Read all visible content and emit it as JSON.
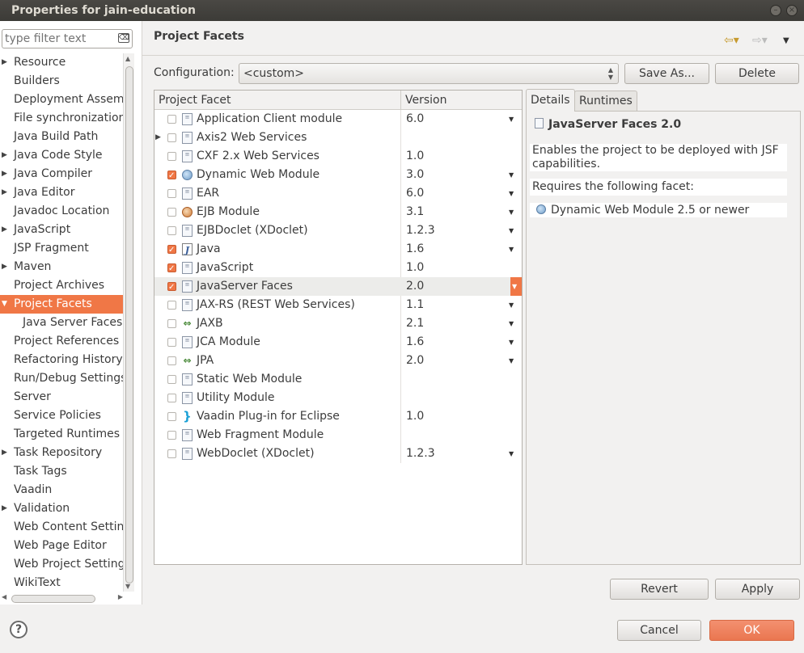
{
  "window": {
    "title": "Properties for jain-education",
    "btn_min": "–",
    "btn_max": "□",
    "btn_close": "×"
  },
  "filter": {
    "placeholder": "type filter text",
    "clear_glyph": "⌫"
  },
  "tree": {
    "items": [
      {
        "label": "Resource",
        "expandable": true,
        "expanded": false,
        "selected": false,
        "level": 0
      },
      {
        "label": "Builders",
        "expandable": false,
        "selected": false,
        "level": 0
      },
      {
        "label": "Deployment Assembly",
        "expandable": false,
        "selected": false,
        "level": 0
      },
      {
        "label": "File synchronization",
        "expandable": false,
        "selected": false,
        "level": 0
      },
      {
        "label": "Java Build Path",
        "expandable": false,
        "selected": false,
        "level": 0
      },
      {
        "label": "Java Code Style",
        "expandable": true,
        "expanded": false,
        "selected": false,
        "level": 0
      },
      {
        "label": "Java Compiler",
        "expandable": true,
        "expanded": false,
        "selected": false,
        "level": 0
      },
      {
        "label": "Java Editor",
        "expandable": true,
        "expanded": false,
        "selected": false,
        "level": 0
      },
      {
        "label": "Javadoc Location",
        "expandable": false,
        "selected": false,
        "level": 0
      },
      {
        "label": "JavaScript",
        "expandable": true,
        "expanded": false,
        "selected": false,
        "level": 0
      },
      {
        "label": "JSP Fragment",
        "expandable": false,
        "selected": false,
        "level": 0
      },
      {
        "label": "Maven",
        "expandable": true,
        "expanded": false,
        "selected": false,
        "level": 0
      },
      {
        "label": "Project Archives",
        "expandable": false,
        "selected": false,
        "level": 0
      },
      {
        "label": "Project Facets",
        "expandable": true,
        "expanded": true,
        "selected": true,
        "level": 0
      },
      {
        "label": "Java Server Faces",
        "expandable": false,
        "selected": false,
        "level": 1
      },
      {
        "label": "Project References",
        "expandable": false,
        "selected": false,
        "level": 0
      },
      {
        "label": "Refactoring History",
        "expandable": false,
        "selected": false,
        "level": 0
      },
      {
        "label": "Run/Debug Settings",
        "expandable": false,
        "selected": false,
        "level": 0
      },
      {
        "label": "Server",
        "expandable": false,
        "selected": false,
        "level": 0
      },
      {
        "label": "Service Policies",
        "expandable": false,
        "selected": false,
        "level": 0
      },
      {
        "label": "Targeted Runtimes",
        "expandable": false,
        "selected": false,
        "level": 0
      },
      {
        "label": "Task Repository",
        "expandable": true,
        "expanded": false,
        "selected": false,
        "level": 0
      },
      {
        "label": "Task Tags",
        "expandable": false,
        "selected": false,
        "level": 0
      },
      {
        "label": "Vaadin",
        "expandable": false,
        "selected": false,
        "level": 0
      },
      {
        "label": "Validation",
        "expandable": true,
        "expanded": false,
        "selected": false,
        "level": 0
      },
      {
        "label": "Web Content Settings",
        "expandable": false,
        "selected": false,
        "level": 0
      },
      {
        "label": "Web Page Editor",
        "expandable": false,
        "selected": false,
        "level": 0
      },
      {
        "label": "Web Project Settings",
        "expandable": false,
        "selected": false,
        "level": 0
      },
      {
        "label": "WikiText",
        "expandable": false,
        "selected": false,
        "level": 0
      }
    ]
  },
  "page": {
    "title": "Project Facets",
    "nav_back": "⇦▾",
    "nav_forward": "⇨▾",
    "nav_menu": "▼"
  },
  "configuration": {
    "label": "Configuration:",
    "value": "<custom>",
    "save_as": "Save As...",
    "delete": "Delete"
  },
  "facets": {
    "col_facet": "Project Facet",
    "col_version": "Version",
    "rows": [
      {
        "name": "Application Client module",
        "version": "6.0",
        "checked": false,
        "icon": "page-icon",
        "has_dropdown": true,
        "expandable": false,
        "selected": false
      },
      {
        "name": "Axis2 Web Services",
        "version": "",
        "checked": false,
        "icon": "page-icon",
        "has_dropdown": false,
        "expandable": true,
        "selected": false
      },
      {
        "name": "CXF 2.x Web Services",
        "version": "1.0",
        "checked": false,
        "icon": "page-icon",
        "has_dropdown": false,
        "expandable": false,
        "selected": false
      },
      {
        "name": "Dynamic Web Module",
        "version": "3.0",
        "checked": true,
        "icon": "web-module-icon",
        "has_dropdown": true,
        "expandable": false,
        "selected": false
      },
      {
        "name": "EAR",
        "version": "6.0",
        "checked": false,
        "icon": "page-icon",
        "has_dropdown": true,
        "expandable": false,
        "selected": false
      },
      {
        "name": "EJB Module",
        "version": "3.1",
        "checked": false,
        "icon": "ejb-module-icon",
        "has_dropdown": true,
        "expandable": false,
        "selected": false
      },
      {
        "name": "EJBDoclet (XDoclet)",
        "version": "1.2.3",
        "checked": false,
        "icon": "page-icon",
        "has_dropdown": true,
        "expandable": false,
        "selected": false
      },
      {
        "name": "Java",
        "version": "1.6",
        "checked": true,
        "icon": "java-icon",
        "has_dropdown": true,
        "expandable": false,
        "selected": false
      },
      {
        "name": "JavaScript",
        "version": "1.0",
        "checked": true,
        "icon": "page-icon",
        "has_dropdown": false,
        "expandable": false,
        "selected": false
      },
      {
        "name": "JavaServer Faces",
        "version": "2.0",
        "checked": true,
        "icon": "page-icon",
        "has_dropdown": true,
        "expandable": false,
        "selected": true
      },
      {
        "name": "JAX-RS (REST Web Services)",
        "version": "1.1",
        "checked": false,
        "icon": "page-icon",
        "has_dropdown": true,
        "expandable": false,
        "selected": false
      },
      {
        "name": "JAXB",
        "version": "2.1",
        "checked": false,
        "icon": "arrows-icon",
        "has_dropdown": true,
        "expandable": false,
        "selected": false
      },
      {
        "name": "JCA Module",
        "version": "1.6",
        "checked": false,
        "icon": "page-icon",
        "has_dropdown": true,
        "expandable": false,
        "selected": false
      },
      {
        "name": "JPA",
        "version": "2.0",
        "checked": false,
        "icon": "arrows-icon",
        "has_dropdown": true,
        "expandable": false,
        "selected": false
      },
      {
        "name": "Static Web Module",
        "version": "",
        "checked": false,
        "icon": "page-icon",
        "has_dropdown": false,
        "expandable": false,
        "selected": false
      },
      {
        "name": "Utility Module",
        "version": "",
        "checked": false,
        "icon": "page-icon",
        "has_dropdown": false,
        "expandable": false,
        "selected": false
      },
      {
        "name": "Vaadin Plug-in for Eclipse",
        "version": "1.0",
        "checked": false,
        "icon": "vaadin-icon",
        "has_dropdown": false,
        "expandable": false,
        "selected": false
      },
      {
        "name": "Web Fragment Module",
        "version": "",
        "checked": false,
        "icon": "page-icon",
        "has_dropdown": false,
        "expandable": false,
        "selected": false
      },
      {
        "name": "WebDoclet (XDoclet)",
        "version": "1.2.3",
        "checked": false,
        "icon": "page-icon",
        "has_dropdown": true,
        "expandable": false,
        "selected": false
      }
    ]
  },
  "details": {
    "tab_details": "Details",
    "tab_runtimes": "Runtimes",
    "title": "JavaServer Faces 2.0",
    "description": "Enables the project to be deployed with JSF capabilities.",
    "requires_label": "Requires the following facet:",
    "requirement": "Dynamic Web Module 2.5 or newer"
  },
  "buttons": {
    "revert": "Revert",
    "apply": "Apply",
    "cancel": "Cancel",
    "ok": "OK",
    "help": "?"
  },
  "colors": {
    "accent": "#f07746",
    "titlebar": "#3c3b37",
    "background": "#f2f1f0"
  }
}
